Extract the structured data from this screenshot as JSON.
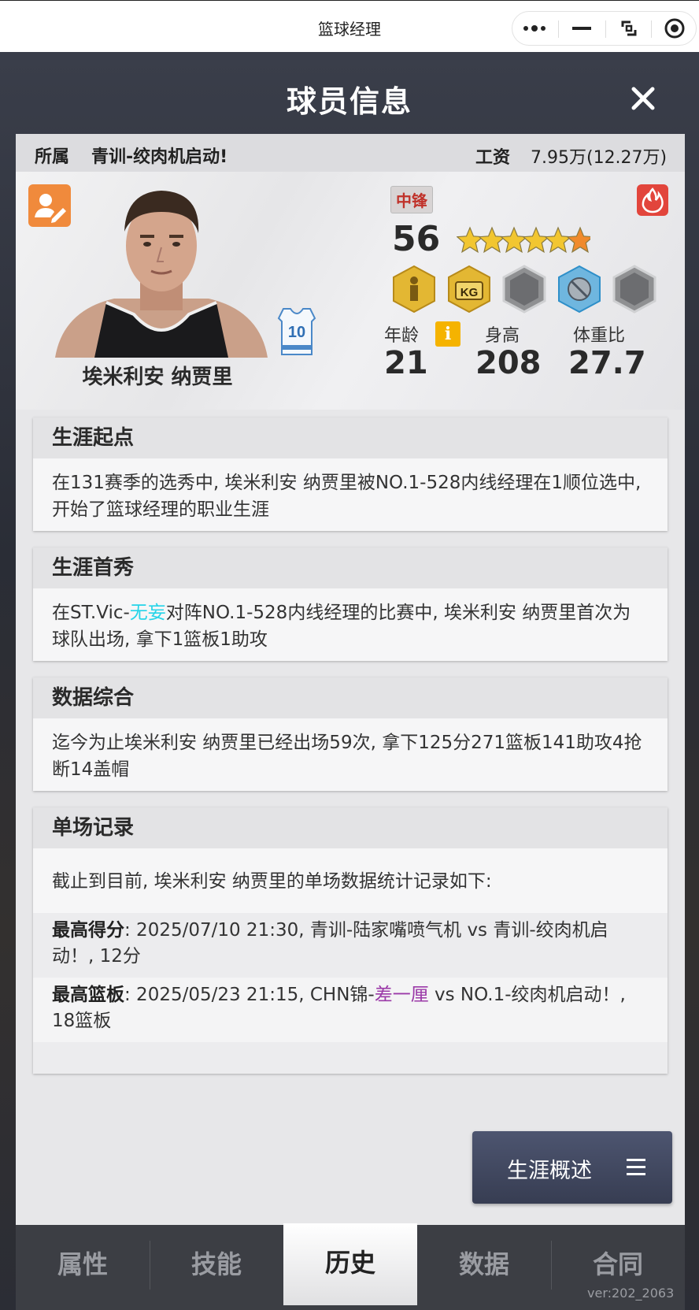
{
  "topbar": {
    "title": "篮球经理"
  },
  "modal": {
    "title": "球员信息"
  },
  "affiliation": {
    "label": "所属",
    "team": "青训-绞肉机启动!",
    "salary_label": "工资",
    "salary": "7.95万(12.27万)"
  },
  "player": {
    "name": "埃米利安 纳贾里",
    "jersey_number": "10",
    "position": "中锋",
    "rating": "56",
    "stars": 5.5,
    "stars_max": 6,
    "age_label": "年龄",
    "age": "21",
    "height_label": "身高",
    "height": "208",
    "weight_ratio_label": "体重比",
    "weight_ratio": "27.7",
    "badges": [
      "player-badge-icon",
      "kg-badge-icon",
      "empty-badge-icon",
      "no-basket-badge-icon",
      "empty-badge-icon"
    ]
  },
  "cards": {
    "start": {
      "title": "生涯起点",
      "body": "在131赛季的选秀中, 埃米利安 纳贾里被NO.1-528内线经理在1顺位选中, 开始了篮球经理的职业生涯"
    },
    "debut": {
      "title": "生涯首秀",
      "body_prefix": "在ST.Vic-",
      "body_highlight": "无妄",
      "body_suffix": "对阵NO.1-528内线经理的比赛中, 埃米利安 纳贾里首次为球队出场, 拿下1篮板1助攻"
    },
    "summary": {
      "title": "数据综合",
      "body": "迄今为止埃米利安 纳贾里已经出场59次, 拿下125分271篮板141助攻4抢断14盖帽"
    },
    "records": {
      "title": "单场记录",
      "intro": "截止到目前, 埃米利安 纳贾里的单场数据统计记录如下:",
      "points_label": "最高得分",
      "points_text": ": 2025/07/10 21:30, 青训-陆家嘴喷气机 vs 青训-绞肉机启动！, 12分",
      "rebounds_label": "最高篮板",
      "rebounds_prefix": ": 2025/05/23 21:15, CHN锦-",
      "rebounds_highlight": "差一厘",
      "rebounds_suffix": " vs NO.1-绞肉机启动！, 18篮板"
    }
  },
  "overview_button": {
    "label": "生涯概述"
  },
  "tabs": [
    "属性",
    "技能",
    "历史",
    "数据",
    "合同"
  ],
  "active_tab": "历史",
  "version": "ver:202_2063",
  "colors": {
    "accent_orange": "#f08a3c",
    "fire_red": "#e2453c",
    "highlight_cyan": "#25d4e8",
    "highlight_purple": "#9b3aa8",
    "position_red": "#c0322a"
  }
}
